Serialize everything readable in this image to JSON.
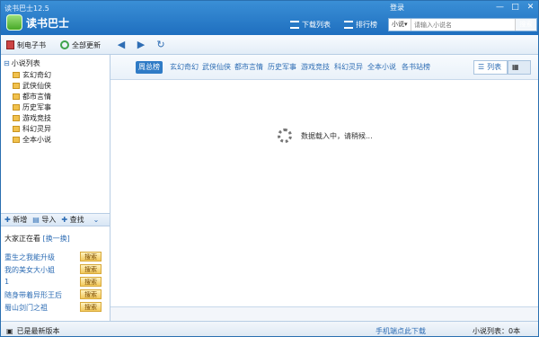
{
  "window": {
    "version_text": "读书巴士12.5",
    "app_name": "读书巴士",
    "login": "登录",
    "controls": [
      "—",
      "□",
      "✕"
    ]
  },
  "top": {
    "download_list": "下载列表",
    "rank_list": "排行榜",
    "search": {
      "category": "小说",
      "placeholder": "请输入小说名",
      "button": "搜索"
    }
  },
  "toolbar": {
    "make_ebook": "制电子书",
    "update_all": "全部更新"
  },
  "sidebar": {
    "root": "小说列表",
    "items": [
      "玄幻奇幻",
      "武侠仙侠",
      "都市言情",
      "历史军事",
      "游戏竞技",
      "科幻灵异",
      "全本小说"
    ],
    "actions": [
      "新增",
      "导入",
      "查找"
    ]
  },
  "popular": {
    "title": "大家正在看",
    "refresh": "[换一换]",
    "items": [
      {
        "title": "重生之我能升级",
        "button": "搜索"
      },
      {
        "title": "我的美女大小姐",
        "button": "搜索"
      },
      {
        "title": "1",
        "button": "搜索"
      },
      {
        "title": "随身带着异形王后",
        "button": "搜索"
      },
      {
        "title": "蜀山剑门之祖",
        "button": "搜索"
      }
    ]
  },
  "content": {
    "tabs": [
      "周总榜",
      "玄幻奇幻",
      "武侠仙侠",
      "都市言情",
      "历史军事",
      "游戏竞技",
      "科幻灵异",
      "全本小说",
      "各书站榜"
    ],
    "view_list": "列表",
    "loading": "数据载入中，请稍候..."
  },
  "status": {
    "left": "已是最新版本",
    "mobile": "手机端点此下载",
    "count": "小说列表：0本"
  }
}
